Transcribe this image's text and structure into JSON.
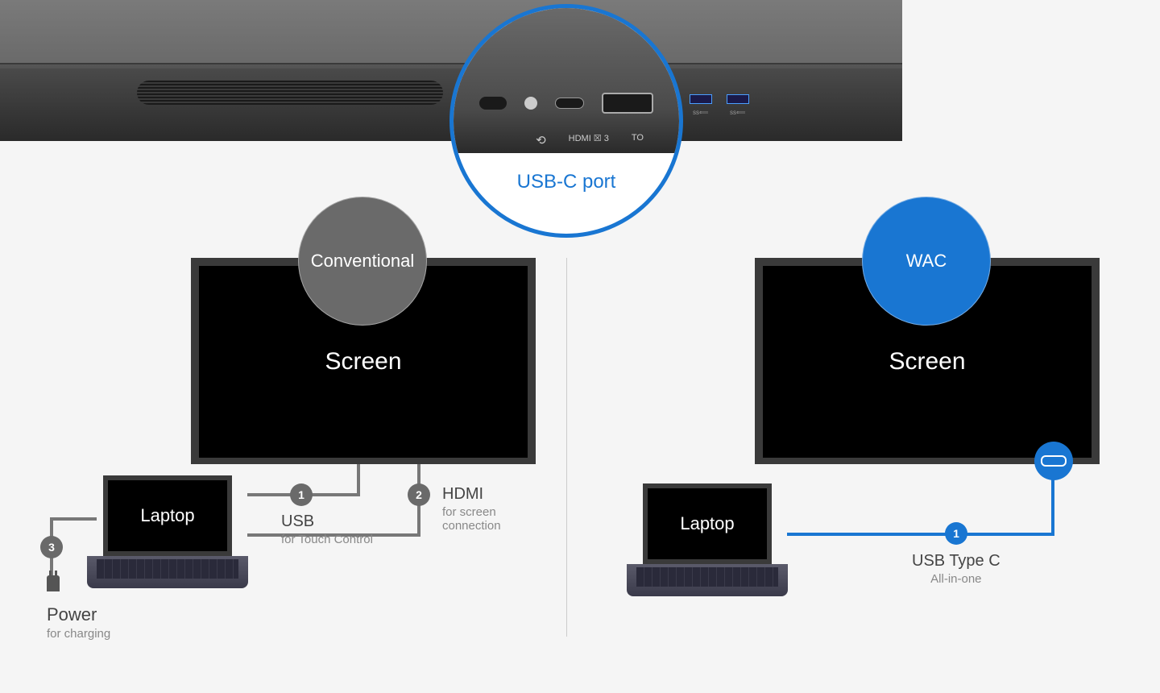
{
  "callout": {
    "label": "USB-C port",
    "usbc_icon_label": "⟲",
    "hdmi_label": "HDMI ☒ 3",
    "touch_label": "TO"
  },
  "device_ports": {
    "hdmi": "3",
    "touch": "TOUCH ☒",
    "usb_ss": "ss⟸"
  },
  "left": {
    "badge": "Conventional",
    "screen": "Screen",
    "laptop": "Laptop",
    "conn1": {
      "num": "1",
      "title": "USB",
      "sub": "for Touch Control"
    },
    "conn2": {
      "num": "2",
      "title": "HDMI",
      "sub1": "for screen",
      "sub2": "connection"
    },
    "conn3": {
      "num": "3",
      "title": "Power",
      "sub": "for charging"
    }
  },
  "right": {
    "badge": "WAC",
    "screen": "Screen",
    "laptop": "Laptop",
    "conn1": {
      "num": "1",
      "title": "USB Type C",
      "sub": "All-in-one"
    }
  }
}
